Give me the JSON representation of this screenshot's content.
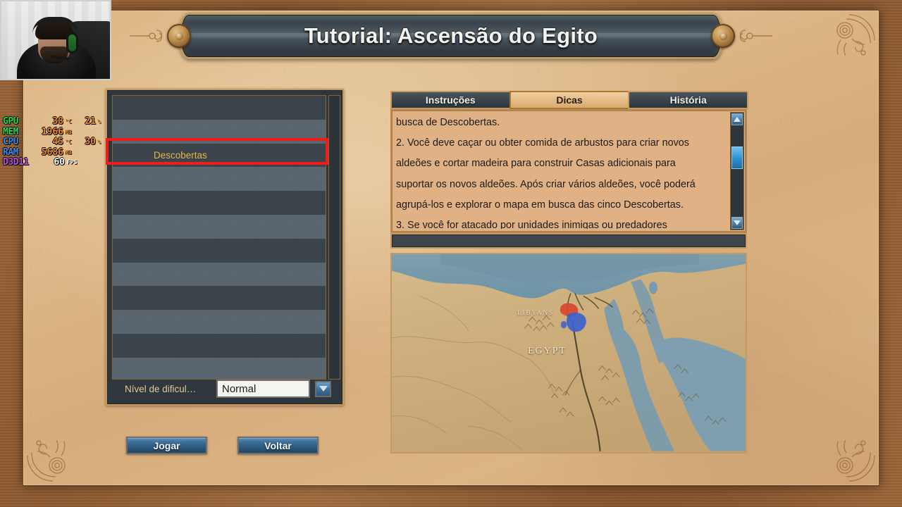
{
  "window": {
    "title": "Tutorial: Ascensão do Egito"
  },
  "scenario_list": {
    "selected_item": "Descobertas",
    "rows": [
      {
        "label": ""
      },
      {
        "label": ""
      },
      {
        "label": "Descobertas"
      },
      {
        "label": ""
      },
      {
        "label": ""
      },
      {
        "label": ""
      },
      {
        "label": ""
      },
      {
        "label": ""
      },
      {
        "label": ""
      },
      {
        "label": ""
      },
      {
        "label": ""
      },
      {
        "label": ""
      }
    ]
  },
  "difficulty": {
    "label": "Nível de dificul…",
    "value": "Normal",
    "arrow_icon": "chevron-down-icon"
  },
  "buttons": {
    "play": "Jogar",
    "back": "Voltar"
  },
  "tabs": [
    {
      "label": "Instruções",
      "active": false
    },
    {
      "label": "Dicas",
      "active": true
    },
    {
      "label": "História",
      "active": false
    }
  ],
  "description": {
    "lines": [
      "busca de Descobertas.",
      "2. Você deve caçar ou obter comida de arbustos para criar novos",
      "aldeões e cortar madeira para construir Casas adicionais para",
      "suportar os novos aldeões. Após criar vários aldeões, você poderá",
      "agrupá-los e explorar o mapa em busca das cinco Descobertas.",
      "3. Se você for atacado por unidades inimigas ou predadores"
    ]
  },
  "scrollbar": {
    "up_icon": "triangle-up-icon",
    "down_icon": "triangle-down-icon",
    "thumb": "scroll-thumb"
  },
  "map": {
    "labels": [
      {
        "name": "LIBYANS"
      },
      {
        "name": "EGYPT"
      }
    ]
  },
  "overlay": {
    "rows": [
      {
        "name": "GPU",
        "color": "#2fd44a",
        "value": "38",
        "unit": "°C",
        "value2": "21",
        "unit2": "%"
      },
      {
        "name": "MEM",
        "color": "#2fd44a",
        "value": "1966",
        "unit": "MB",
        "value2": "",
        "unit2": ""
      },
      {
        "name": "CPU",
        "color": "#3a8ae8",
        "value": "45",
        "unit": "°C",
        "value2": "30",
        "unit2": "%"
      },
      {
        "name": "RAM",
        "color": "#3a8ae8",
        "value": "5686",
        "unit": "MB",
        "value2": "",
        "unit2": ""
      }
    ],
    "fps": {
      "name": "D3D11",
      "color": "#b452d8",
      "value": "60",
      "unit": "FPS"
    }
  },
  "annotation": {
    "color": "#ef1c1c"
  }
}
